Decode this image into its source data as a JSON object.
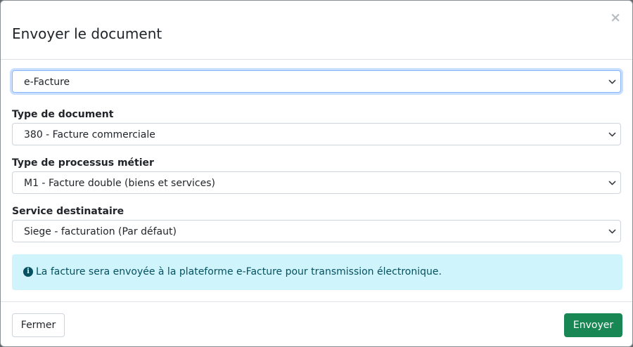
{
  "dialog": {
    "title": "Envoyer le document",
    "close_symbol": "×"
  },
  "fields": {
    "platform": {
      "value": "e-Facture"
    },
    "document_type": {
      "label": "Type de document",
      "value": "380 - Facture commerciale"
    },
    "process_type": {
      "label": "Type de processus métier",
      "value": "M1 - Facture double (biens et services)"
    },
    "recipient_service": {
      "label": "Service destinataire",
      "value": "Siege - facturation (Par défaut)"
    }
  },
  "info": {
    "icon": "info-circle-icon",
    "text": "La facture sera envoyée à la plateforme e-Facture pour transmission électronique."
  },
  "footer": {
    "close_label": "Fermer",
    "send_label": "Envoyer"
  },
  "colors": {
    "primary_success": "#198754",
    "info_bg": "#cff4fc",
    "info_text": "#055160",
    "focus_border": "#86b7fe"
  }
}
